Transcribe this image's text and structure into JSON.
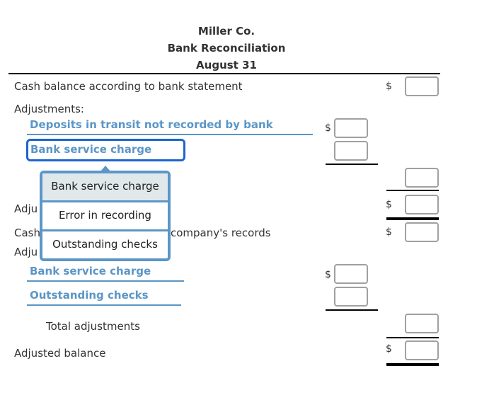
{
  "header": {
    "company": "Miller Co.",
    "title": "Bank Reconciliation",
    "date": "August 31"
  },
  "bank_section": {
    "balance_label": "Cash balance according to bank statement",
    "adjustments_label": "Adjustments:",
    "rows": [
      {
        "label": "Deposits in transit not recorded by bank",
        "currency": "$",
        "value": ""
      },
      {
        "label": "Bank service charge",
        "currency": "",
        "value": ""
      }
    ],
    "total_value": "",
    "adjusted_label_partial": "Adju",
    "adjusted_currency": "$",
    "adjusted_value": ""
  },
  "company_section": {
    "balance_label_partial_left": "Cash",
    "balance_label_partial_right": "company's records",
    "balance_currency": "$",
    "balance_value": "",
    "adjustments_label_partial": "Adju",
    "rows": [
      {
        "label": "Bank service charge",
        "currency": "$",
        "value": ""
      },
      {
        "label": "Outstanding checks",
        "currency": "",
        "value": ""
      }
    ],
    "total_label": "Total adjustments",
    "total_value": "",
    "adjusted_label": "Adjusted balance",
    "adjusted_currency": "$",
    "adjusted_value": ""
  },
  "dropdown": {
    "options": [
      "Bank service charge",
      "Error in recording",
      "Outstanding checks"
    ],
    "highlighted": "Bank service charge"
  },
  "colors": {
    "accent": "#5b96c6",
    "focus": "#1a66cc",
    "highlight": "#e1e8eb"
  }
}
